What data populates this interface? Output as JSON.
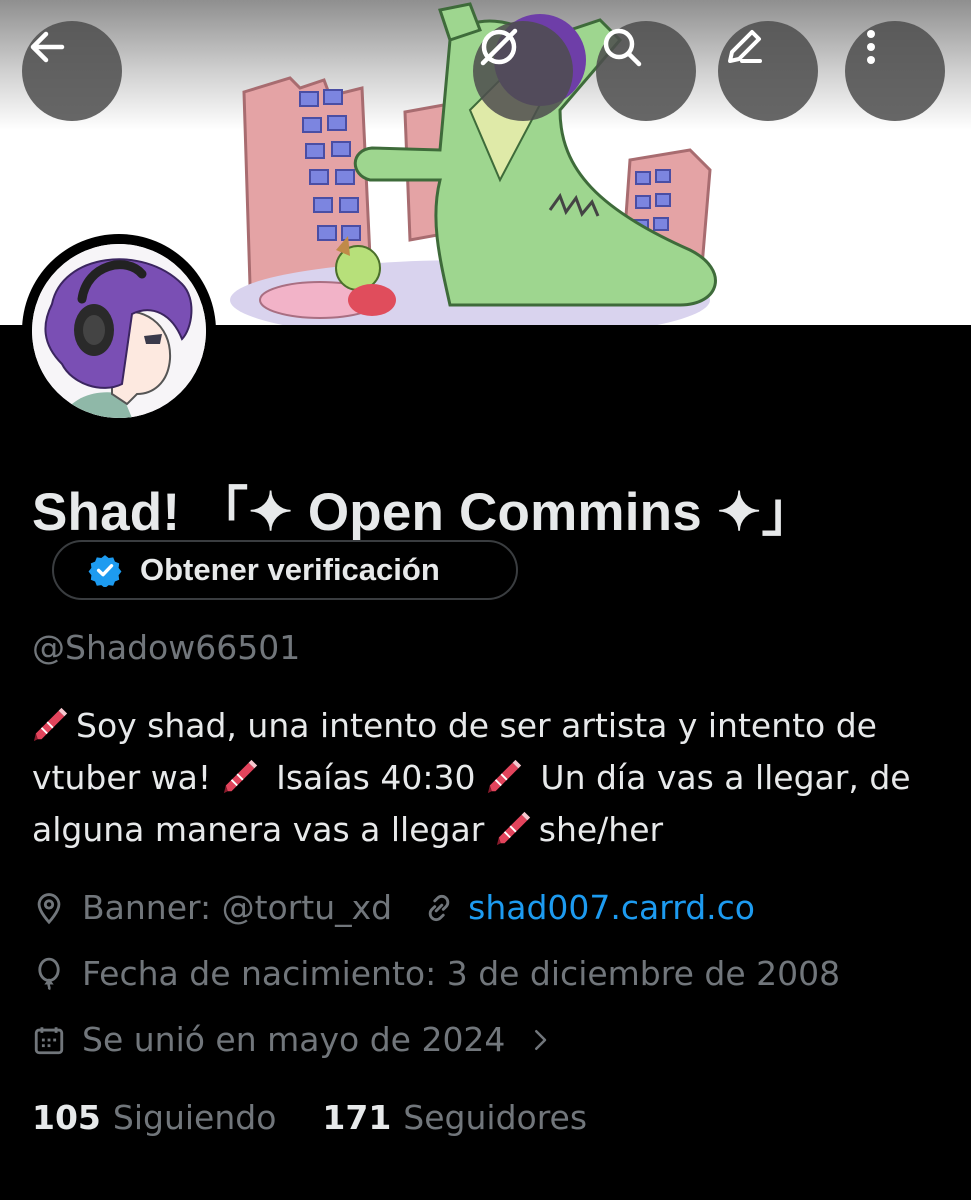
{
  "header": {
    "back_icon": "arrow-left-icon",
    "refresh_icon": "rotate-slash-icon",
    "search_icon": "search-icon",
    "edit_icon": "pencil-icon",
    "more_icon": "kebab-icon"
  },
  "profile": {
    "display_name": "Shad! 「✦ Open Commins ✦」",
    "verify_label": "Obtener verificación",
    "handle": "@Shadow66501",
    "bio": [
      {
        "crayon": true,
        "text": "Soy shad, una intento de ser artista y intento de vtuber wa! "
      },
      {
        "crayon": true,
        "text": " Isaías 40:30 "
      },
      {
        "crayon": true,
        "text": " Un día vas a llegar, de alguna manera vas a llegar "
      },
      {
        "crayon": true,
        "text": "she/her"
      }
    ],
    "location": "Banner: @tortu_xd",
    "website": "shad007.carrd.co",
    "birthday": "Fecha de nacimiento: 3 de diciembre de 2008",
    "joined": "Se unió en mayo de 2024",
    "following_count": "105",
    "following_label": "Siguiendo",
    "followers_count": "171",
    "followers_label": "Seguidores"
  },
  "colors": {
    "background": "#000000",
    "text": "#e7e9ea",
    "muted": "#71767b",
    "link": "#1d9bf0",
    "verify_badge": "#1d9bf0"
  }
}
